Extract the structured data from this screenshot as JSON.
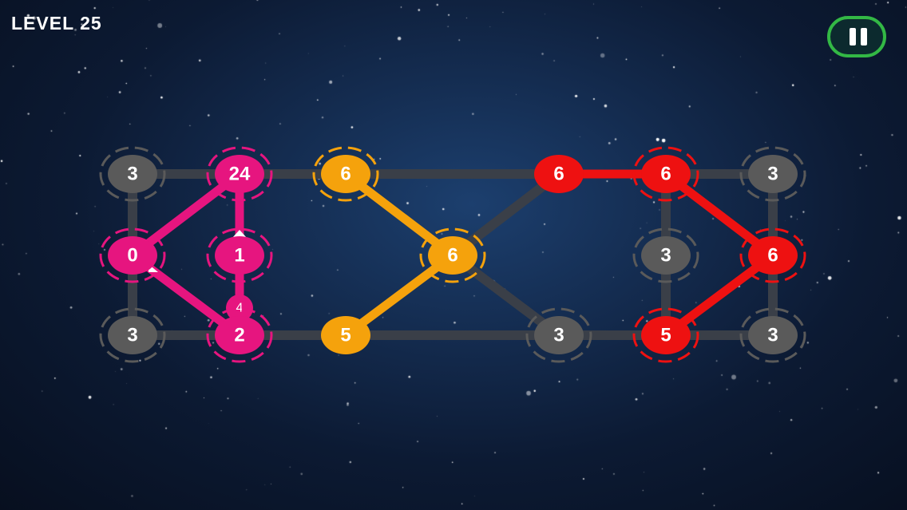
{
  "level": {
    "title": "LEVEL 25"
  },
  "pause": {
    "icon": "pause-icon"
  },
  "colors": {
    "gray": "#5a5a5a",
    "pink": "#e6157f",
    "orange": "#f5a20c",
    "red": "#ee1111",
    "track": "#3a3f48"
  },
  "nodes": [
    {
      "id": "n00",
      "label": "3",
      "color": "gray",
      "ring": true
    },
    {
      "id": "n01",
      "label": "24",
      "color": "pink",
      "ring": true
    },
    {
      "id": "n02",
      "label": "6",
      "color": "orange",
      "ring": true
    },
    {
      "id": "n03",
      "label": "6",
      "color": "red",
      "ring": false
    },
    {
      "id": "n04",
      "label": "6",
      "color": "red",
      "ring": true
    },
    {
      "id": "n05",
      "label": "3",
      "color": "gray",
      "ring": true
    },
    {
      "id": "n10",
      "label": "0",
      "color": "pink",
      "ring": true
    },
    {
      "id": "n11",
      "label": "1",
      "color": "pink",
      "ring": true
    },
    {
      "id": "n12",
      "label": "6",
      "color": "orange",
      "ring": true
    },
    {
      "id": "n13",
      "label": "3",
      "color": "gray",
      "ring": true
    },
    {
      "id": "n14",
      "label": "6",
      "color": "red",
      "ring": true
    },
    {
      "id": "n20",
      "label": "3",
      "color": "gray",
      "ring": true
    },
    {
      "id": "n21",
      "label": "2",
      "color": "pink",
      "ring": true
    },
    {
      "id": "n22",
      "label": "5",
      "color": "orange",
      "ring": false
    },
    {
      "id": "n23",
      "label": "3",
      "color": "gray",
      "ring": true
    },
    {
      "id": "n24",
      "label": "5",
      "color": "red",
      "ring": true
    },
    {
      "id": "n25",
      "label": "3",
      "color": "gray",
      "ring": true
    }
  ],
  "edges": [
    {
      "from": "n00",
      "to": "n01",
      "color": "track"
    },
    {
      "from": "n01",
      "to": "n02",
      "color": "track"
    },
    {
      "from": "n02",
      "to": "n03",
      "color": "track"
    },
    {
      "from": "n04",
      "to": "n05",
      "color": "track"
    },
    {
      "from": "n00",
      "to": "n10",
      "color": "track"
    },
    {
      "from": "n10",
      "to": "n20",
      "color": "track"
    },
    {
      "from": "n05",
      "to": "n25",
      "color": "track"
    },
    {
      "from": "n04",
      "to": "n13",
      "color": "track"
    },
    {
      "from": "n13",
      "to": "n24",
      "color": "track"
    },
    {
      "from": "n20",
      "to": "n21",
      "color": "track"
    },
    {
      "from": "n21",
      "to": "n22",
      "color": "track"
    },
    {
      "from": "n22",
      "to": "n23",
      "color": "track"
    },
    {
      "from": "n23",
      "to": "n24",
      "color": "track"
    },
    {
      "from": "n24",
      "to": "n25",
      "color": "track"
    },
    {
      "from": "n12",
      "to": "n03",
      "color": "track"
    },
    {
      "from": "n12",
      "to": "n23",
      "color": "track"
    },
    {
      "from": "n01",
      "to": "n10",
      "color": "pink"
    },
    {
      "from": "n10",
      "to": "n21",
      "color": "pink"
    },
    {
      "from": "n01",
      "to": "n11",
      "color": "pink"
    },
    {
      "from": "n11",
      "to": "n21",
      "color": "pink",
      "label": "4"
    },
    {
      "from": "n02",
      "to": "n12",
      "color": "orange"
    },
    {
      "from": "n12",
      "to": "n22",
      "color": "orange"
    },
    {
      "from": "n03",
      "to": "n04",
      "color": "red"
    },
    {
      "from": "n04",
      "to": "n14",
      "color": "red"
    },
    {
      "from": "n14",
      "to": "n24",
      "color": "red"
    }
  ]
}
